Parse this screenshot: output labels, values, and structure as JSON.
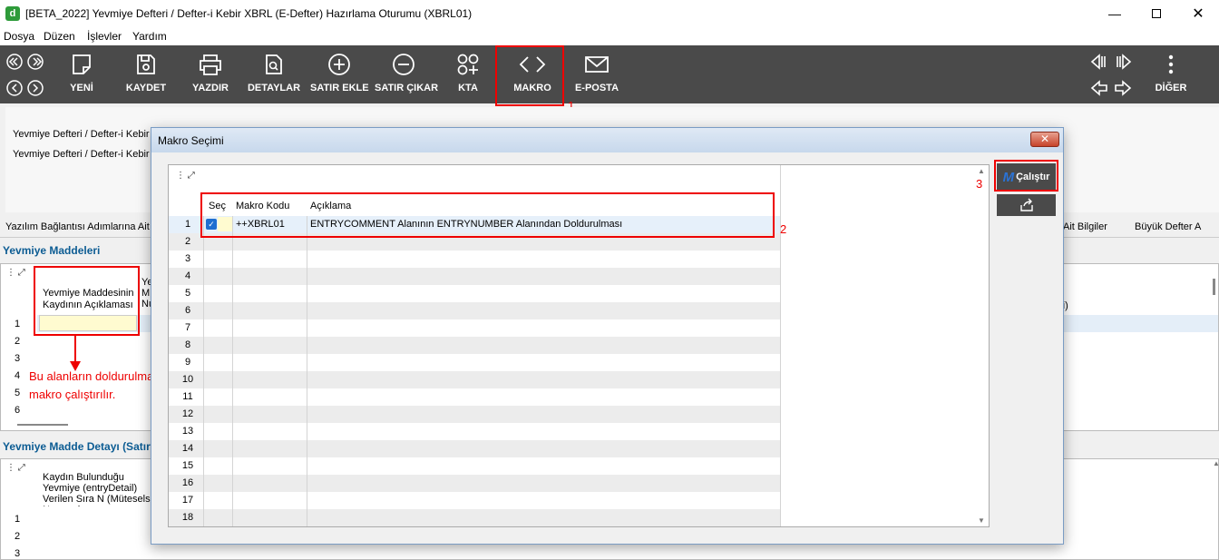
{
  "window": {
    "title": "[BETA_2022] Yevmiye Defteri / Defter-i Kebir XBRL (E-Defter) Hazırlama Oturumu (XBRL01)",
    "app_icon_letter": "d"
  },
  "menu": [
    "Dosya",
    "Düzen",
    "İşlevler",
    "Yardım"
  ],
  "toolbar": {
    "buttons": [
      {
        "label": "YENİ",
        "icon": "new-doc-icon"
      },
      {
        "label": "KAYDET",
        "icon": "save-icon"
      },
      {
        "label": "YAZDIR",
        "icon": "printer-icon"
      },
      {
        "label": "DETAYLAR",
        "icon": "details-icon"
      },
      {
        "label": "SATIR EKLE",
        "icon": "plus-circle-icon"
      },
      {
        "label": "SATIR ÇIKAR",
        "icon": "minus-circle-icon"
      },
      {
        "label": "KTA",
        "icon": "kta-icon"
      },
      {
        "label": "MAKRO",
        "icon": "code-icon"
      },
      {
        "label": "E-POSTA",
        "icon": "mail-icon"
      },
      {
        "label": "DİĞER",
        "icon": "more-vertical-icon"
      }
    ]
  },
  "background": {
    "form_lines": [
      "Yevmiye Defteri / Defter-i Kebir X",
      "Yevmiye Defteri / Defter-i Kebir X"
    ],
    "tab_left": "Yazılım Bağlantısı Adımlarına Ait Bi",
    "tab_right_1": "Ait Bilgiler",
    "tab_right_2": "Büyük Defter A",
    "section_entries": "Yevmiye Maddeleri",
    "entries_col_header": "Yevmiye Maddesinin Kaydının Açıklaması",
    "entries_col2_fragment": [
      "Ye",
      "M",
      "Nu"
    ],
    "entries_right_fragment": "neli)",
    "entries_rows": [
      "1",
      "2",
      "3",
      "4",
      "5",
      "6"
    ],
    "section_details": "Yevmiye Madde Detayı (Satır",
    "details_col_header": "Kaydın Bulunduğu Yevmiye (entryDetail) Verilen Sıra N (Müteselsil Numara)",
    "details_rows": [
      "1",
      "2",
      "3"
    ]
  },
  "annotations": {
    "note": "Bu alanların doldurulması için makro çalıştırılır.",
    "marker_1": "1",
    "marker_2": "2",
    "marker_3": "3"
  },
  "dialog": {
    "title": "Makro Seçimi",
    "close_symbol": "✕",
    "columns": [
      "Seç",
      "Makro Kodu",
      "Açıklama"
    ],
    "rows": [
      {
        "num": "1",
        "selected": true,
        "code": "++XBRL01",
        "description": "ENTRYCOMMENT Alanının ENTRYNUMBER Alanından Doldurulması"
      }
    ],
    "row_numbers": [
      "1",
      "2",
      "3",
      "4",
      "5",
      "6",
      "7",
      "8",
      "9",
      "10",
      "11",
      "12",
      "13",
      "14",
      "15",
      "16",
      "17",
      "18"
    ],
    "run_button": "Çalıştır",
    "run_button_logo": "M"
  }
}
